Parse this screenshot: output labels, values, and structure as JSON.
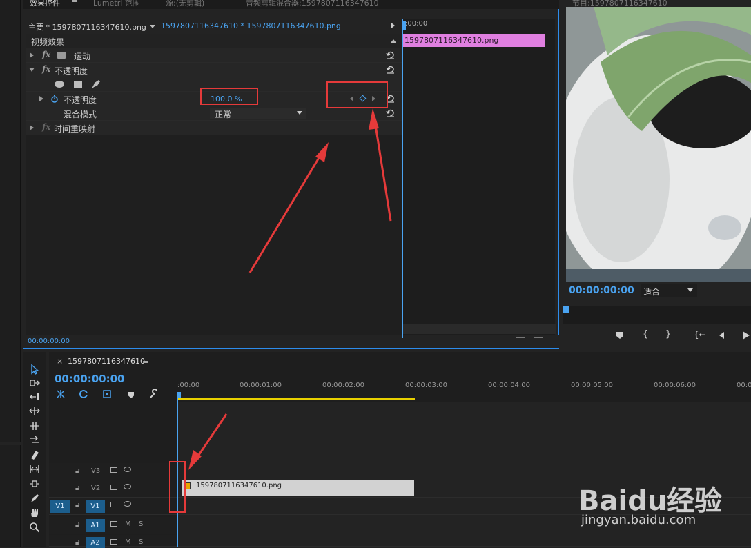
{
  "tabs": {
    "effect_controls": "效果控件",
    "effect_controls_menu": "≡",
    "lumetri": "Lumetri 范围",
    "source": "源:(无剪辑)",
    "audio_mixer": "音频剪辑混合器:1597807116347610",
    "program": "节目:1597807116347610"
  },
  "effects": {
    "master_label": "主要 * 1597807116347610.png",
    "sequence_label": "1597807116347610 * 1597807116347610.png",
    "section_title": "视频效果",
    "time_start": ":00:00",
    "clip_name": "1597807116347610.png",
    "rows": {
      "motion": "运动",
      "opacity": "不透明度",
      "opacity_param": "不透明度",
      "opacity_value": "100.0 %",
      "blend_mode": "混合模式",
      "blend_value": "正常",
      "time_remap": "时间重映射"
    },
    "footer_time": "00:00:00:00"
  },
  "program": {
    "timecode": "00:00:00:00",
    "fit_label": "适合"
  },
  "timeline": {
    "tab_label": "1597807116347610",
    "tab_menu": "≡",
    "close_glyph": "×",
    "timecode": "00:00:00:00",
    "ruler_labels": [
      ":00:00",
      "00:00:01:00",
      "00:00:02:00",
      "00:00:03:00",
      "00:00:04:00",
      "00:00:05:00",
      "00:00:06:00",
      "00:00"
    ],
    "tracks": {
      "v3": "V3",
      "v2": "V2",
      "v1": "V1",
      "v1_source": "V1",
      "a1": "A1",
      "a2": "A2",
      "m": "M",
      "s": "S"
    },
    "clip_name": "1597807116347610.png"
  },
  "watermark": {
    "brand": "Baidu经验",
    "url": "jingyan.baidu.com"
  },
  "colors": {
    "accent": "#2d8ceb",
    "clip_pink": "#e07fe0",
    "annotation_red": "#e53a3a"
  }
}
